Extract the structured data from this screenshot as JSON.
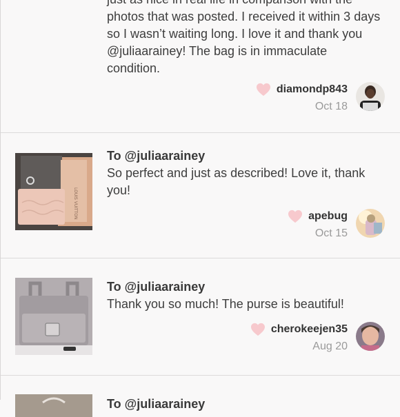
{
  "reviews": [
    {
      "to_line": "",
      "text": "just as nice in real life in comparison with the photos that was posted. I received it within 3 days so I wasn’t waiting long. I love it and thank you @juliaarainey! The bag is in immaculate condition.",
      "username": "diamondp843",
      "date": "Oct 18",
      "avatar_icon": "avatar-photo-icon"
    },
    {
      "to_line": "To @juliaarainey",
      "text": "So perfect and just as described! Love it, thank you!",
      "username": "apebug",
      "date": "Oct 15",
      "thumb_icon": "wallet-pouch-photo",
      "avatar_icon": "avatar-photo-icon"
    },
    {
      "to_line": "To @juliaarainey",
      "text": "Thank you so much! The purse is beautiful!",
      "username": "cherokeejen35",
      "date": "Aug 20",
      "thumb_icon": "gray-purse-photo",
      "avatar_icon": "avatar-photo-icon"
    },
    {
      "to_line": "To @juliaarainey",
      "text": "",
      "username": "",
      "date": "",
      "thumb_icon": "product-photo"
    }
  ],
  "colors": {
    "heart": "#f7c9cd",
    "divider": "#dcdada",
    "background": "#f9f8f8"
  }
}
